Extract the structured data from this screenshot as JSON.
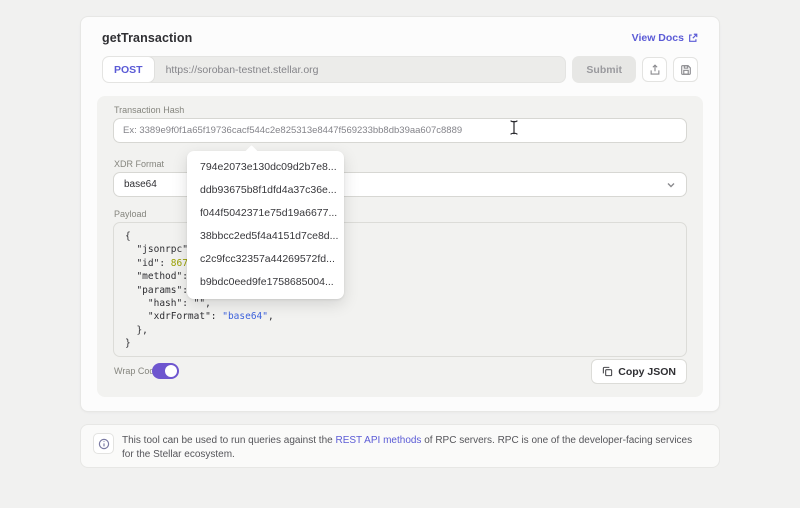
{
  "header": {
    "title": "getTransaction",
    "view_docs_label": "View Docs"
  },
  "request_bar": {
    "method": "POST",
    "url": "https://soroban-testnet.stellar.org",
    "submit_label": "Submit"
  },
  "form": {
    "transaction_hash": {
      "label": "Transaction Hash",
      "value": "",
      "placeholder": "Ex: 3389e9f0f1a65f19736cacf544c2e825313e8447f569233bb8db39aa607c8889"
    },
    "xdr_format": {
      "label": "XDR Format",
      "value": "base64"
    },
    "payload": {
      "label": "Payload"
    },
    "wrap_code": {
      "label": "Wrap Code",
      "enabled": true
    },
    "copy_json_label": "Copy JSON"
  },
  "hash_suggestions": [
    "794e2073e130dc09d2b7e8...",
    "ddb93675b8f1dfd4a37c36e...",
    "f044f5042371e75d19a6677...",
    "38bbcc2ed5f4a4151d7ce8d...",
    "c2c9fcc32357a44269572fd...",
    "b9bdc0eed9fe1758685004..."
  ],
  "payload_code": {
    "lines": [
      [
        {
          "t": "{",
          "c": "p"
        }
      ],
      [
        {
          "t": "  \"jsonrpc\": ",
          "c": "p"
        }
      ],
      [
        {
          "t": "  \"id\": ",
          "c": "p"
        },
        {
          "t": "86753",
          "c": "num"
        }
      ],
      [
        {
          "t": "  \"method\": \"",
          "c": "p"
        }
      ],
      [
        {
          "t": "  \"params\": {",
          "c": "p"
        }
      ],
      [
        {
          "t": "    \"hash\": \"\",",
          "c": "p"
        }
      ],
      [
        {
          "t": "    \"xdrFormat\": ",
          "c": "p"
        },
        {
          "t": "\"base64\"",
          "c": "str"
        },
        {
          "t": ",",
          "c": "p"
        }
      ],
      [
        {
          "t": "  },",
          "c": "p"
        }
      ],
      [
        {
          "t": "}",
          "c": "p"
        }
      ]
    ]
  },
  "info_banner": {
    "text_before": "This tool can be used to run queries against the ",
    "link_label": "REST API methods",
    "text_after": " of RPC servers. RPC is one of the developer-facing services for the Stellar ecosystem."
  },
  "colors": {
    "accent_purple": "#5b5bd6",
    "toggle_purple": "#6e56cf",
    "code_number": "#9aa000",
    "code_string": "#3e63dd",
    "page_background": "#f1f1f0",
    "card_background": "#fcfcfc",
    "panel_background": "#f2f2f0"
  }
}
